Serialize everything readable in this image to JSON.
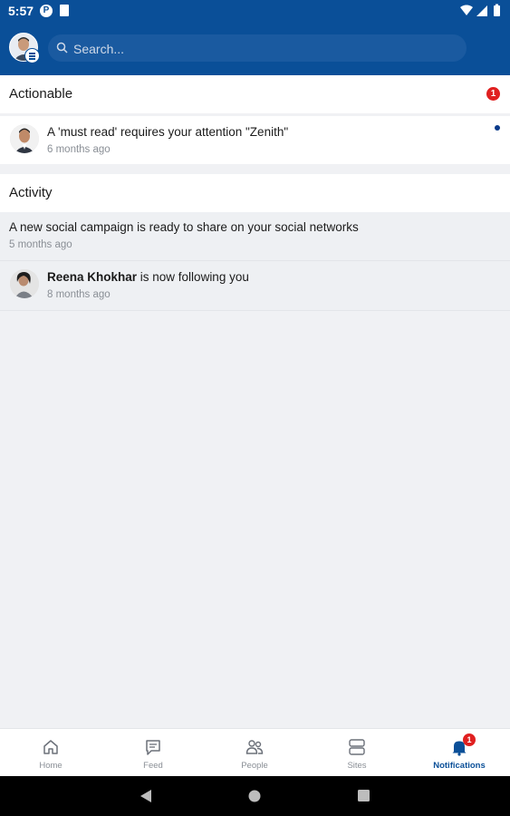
{
  "status_bar": {
    "time": "5:57"
  },
  "search": {
    "placeholder": "Search..."
  },
  "sections": {
    "actionable": {
      "title": "Actionable",
      "count": "1"
    },
    "activity": {
      "title": "Activity"
    }
  },
  "actionable_items": [
    {
      "text": "A 'must read' requires your attention \"Zenith\"",
      "time": "6 months ago"
    }
  ],
  "activity_items": [
    {
      "text": "A new social campaign is ready to share on your social networks",
      "time": "5 months ago"
    },
    {
      "name": "Reena Khokhar",
      "text_suffix": " is now following you",
      "time": "8 months ago"
    }
  ],
  "tabs": [
    {
      "label": "Home",
      "icon": "home-icon"
    },
    {
      "label": "Feed",
      "icon": "feed-icon"
    },
    {
      "label": "People",
      "icon": "people-icon"
    },
    {
      "label": "Sites",
      "icon": "sites-icon"
    },
    {
      "label": "Notifications",
      "icon": "bell-icon",
      "badge": "1",
      "active": true
    }
  ],
  "colors": {
    "brand": "#0a4f98",
    "badge": "#e02020",
    "background": "#f0f1f4"
  }
}
